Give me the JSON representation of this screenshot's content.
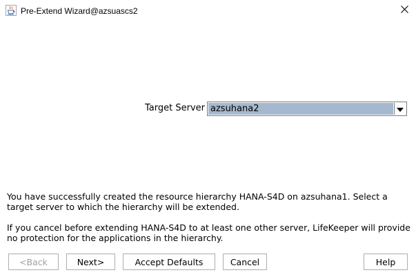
{
  "window": {
    "title": "Pre-Extend Wizard@azsuascs2",
    "close_glyph": "✕"
  },
  "form": {
    "target_server_label": "Target Server",
    "target_server_value": "azsuhana2"
  },
  "messages": {
    "line1": "You have successfully created the resource hierarchy HANA-S4D on azsuhana1. Select a target server to which the hierarchy will be extended.",
    "line2": "If you cancel before extending HANA-S4D to at least one other server, LifeKeeper will provide no protection for the applications in the hierarchy."
  },
  "buttons": {
    "back": "<Back",
    "next": "Next>",
    "accept_defaults": "Accept Defaults",
    "cancel": "Cancel",
    "help": "Help"
  },
  "icons": {
    "app": "java-cup-icon",
    "close": "close-icon",
    "dropdown": "chevron-down-icon"
  },
  "colors": {
    "selection": "#a6b8cf",
    "border": "#adadad",
    "disabled_text": "#a0a0a0"
  }
}
